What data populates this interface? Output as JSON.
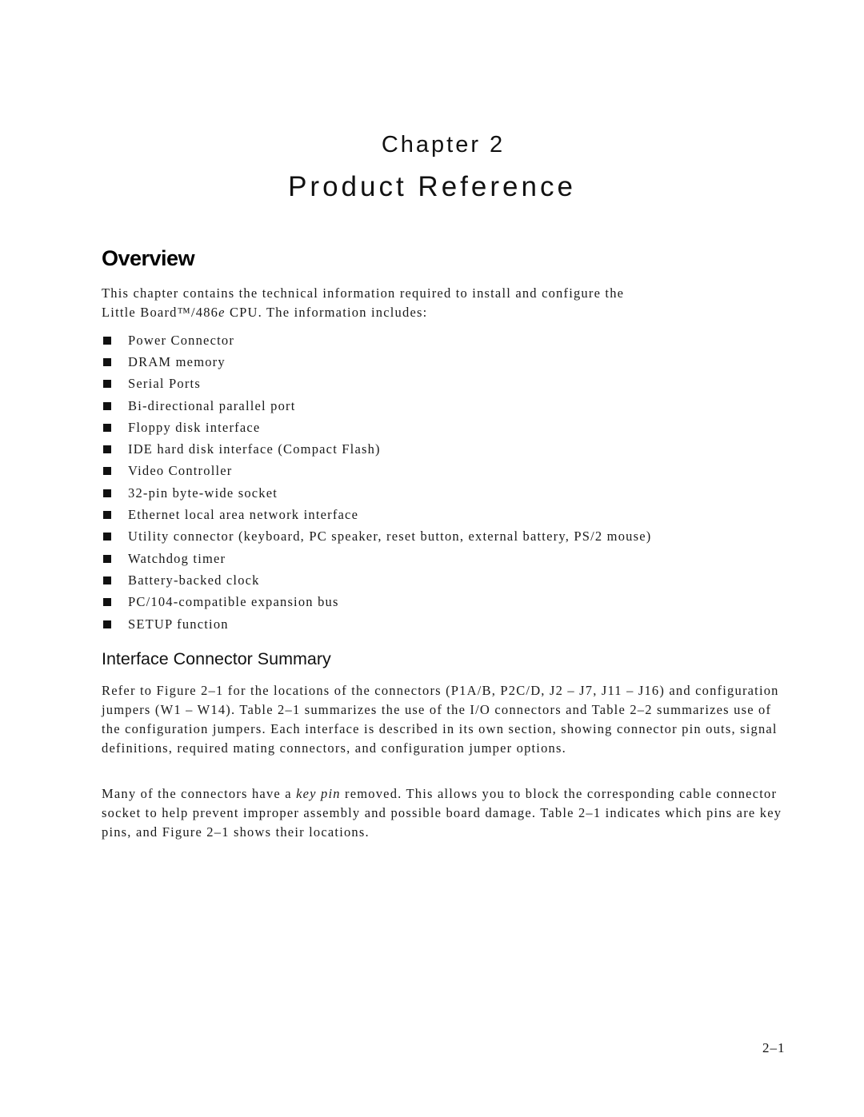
{
  "chapter": {
    "label": "Chapter 2",
    "title": "Product Reference"
  },
  "overview": {
    "heading": "Overview",
    "intro_line1": "This chapter contains the technical information required to install and configure the",
    "intro_line2_a": "Little Board™/486",
    "intro_line2_italic": "e",
    "intro_line2_b": " CPU. The information includes:",
    "bullet_icon": "square-bullet-icon",
    "items": [
      "Power Connector",
      "DRAM memory",
      "Serial Ports",
      "Bi-directional parallel port",
      "Floppy disk interface",
      "IDE hard disk interface (Compact Flash)",
      "Video Controller",
      "32-pin byte-wide socket",
      "Ethernet local area network interface",
      "Utility connector (keyboard, PC speaker, reset button, external battery, PS/2 mouse)",
      "Watchdog timer",
      "Battery-backed clock",
      "PC/104-compatible expansion bus",
      "SETUP function"
    ]
  },
  "interface_summary": {
    "heading": "Interface Connector Summary",
    "para1": "Refer to Figure 2–1 for the locations of the connectors (P1A/B, P2C/D, J2 – J7, J11 – J16) and configuration jumpers (W1 – W14). Table 2–1 summarizes the use of the I/O connectors and Table 2–2 summarizes use of the configuration jumpers. Each interface is described in its own section, showing connector pin outs, signal definitions, required mating connectors, and configuration jumper options.",
    "para2_a": "Many of the connectors have a ",
    "para2_italic": "key pin",
    "para2_b": " removed. This allows you to block the corresponding cable connector socket to help prevent improper assembly and possible board damage. Table 2–1 indicates which pins are key pins, and Figure 2–1 shows their locations."
  },
  "footer": {
    "page_number": "2–1"
  }
}
